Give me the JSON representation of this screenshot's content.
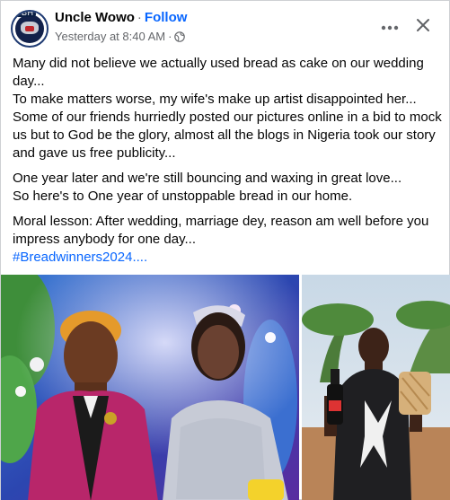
{
  "post": {
    "author": "Uncle Wowo",
    "separator": "·",
    "follow_label": "Follow",
    "timestamp": "Yesterday at 8:40 AM",
    "meta_separator": "·",
    "audience_icon": "globe-icon",
    "avatar_badge": "TBH"
  },
  "actions": {
    "more_icon": "more-options-icon",
    "close_icon": "close-icon"
  },
  "body": {
    "paragraph_1": "Many did not believe we actually used bread as cake on our wedding day...",
    "paragraph_2": "To make matters worse, my wife's make up artist disappointed her... Some of our friends hurriedly posted our pictures online in a bid to mock us but to God be the glory, almost all the blogs in Nigeria took our story and gave us free publicity...",
    "paragraph_3": "One year later and we're still bouncing and waxing in great love...",
    "paragraph_4": "So here's to One year of unstoppable bread in our home.",
    "paragraph_5": "Moral lesson: After wedding, marriage dey, reason am well before you impress anybody for one day...",
    "hashtag": "#Breadwinners2024",
    "hashtag_suffix": "...."
  },
  "colors": {
    "link": "#0866ff",
    "meta": "#65676b",
    "text": "#050505",
    "border": "#ced0d4"
  }
}
